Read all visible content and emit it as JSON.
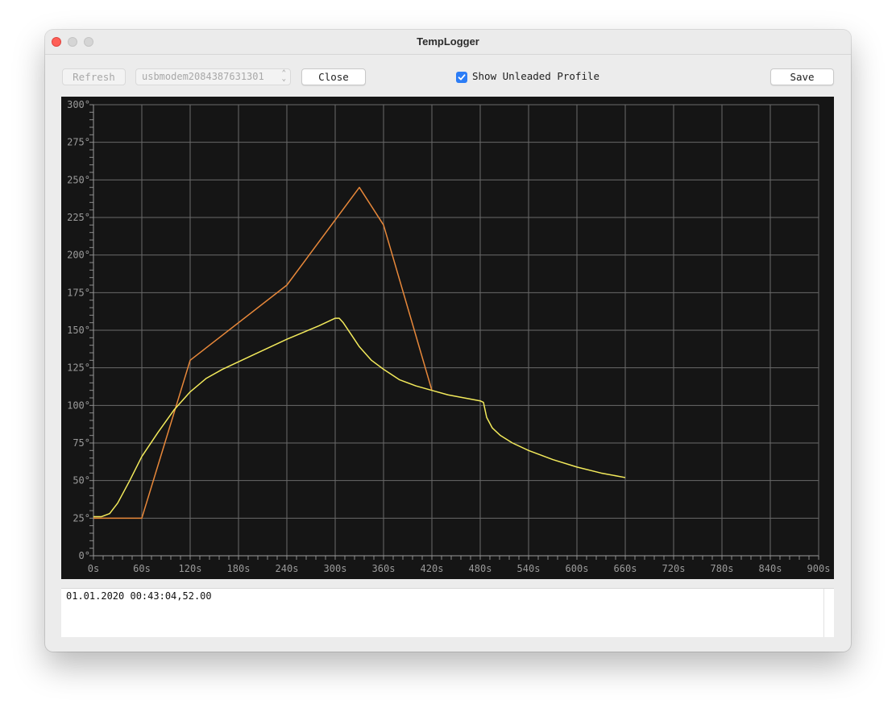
{
  "window": {
    "title": "TempLogger"
  },
  "toolbar": {
    "refresh_label": "Refresh",
    "port_value": "usbmodem2084387631301",
    "close_label": "Close",
    "show_profile_label": "Show Unleaded Profile",
    "show_profile_checked": true,
    "save_label": "Save"
  },
  "log": {
    "text": "01.01.2020 00:43:04,52.00"
  },
  "colors": {
    "profile": "#e8883a",
    "measured": "#f3ea5b",
    "background": "#151515",
    "grid": "#6a6a6a"
  },
  "chart_data": {
    "type": "line",
    "xlim": [
      0,
      900
    ],
    "ylim": [
      0,
      300
    ],
    "x_ticks": [
      0,
      60,
      120,
      180,
      240,
      300,
      360,
      420,
      480,
      540,
      600,
      660,
      720,
      780,
      840,
      900
    ],
    "x_tick_labels": [
      "0s",
      "60s",
      "120s",
      "180s",
      "240s",
      "300s",
      "360s",
      "420s",
      "480s",
      "540s",
      "600s",
      "660s",
      "720s",
      "780s",
      "840s",
      "900s"
    ],
    "y_ticks": [
      0,
      25,
      50,
      75,
      100,
      125,
      150,
      175,
      200,
      225,
      250,
      275,
      300
    ],
    "y_tick_labels": [
      "0°",
      "25°",
      "50°",
      "75°",
      "100°",
      "125°",
      "150°",
      "175°",
      "200°",
      "225°",
      "250°",
      "275°",
      "300°"
    ],
    "grid": true,
    "series": [
      {
        "color": "#e8883a",
        "x": [
          0,
          60,
          120,
          240,
          330,
          360,
          420
        ],
        "y": [
          25,
          25,
          130,
          180,
          245,
          220,
          110
        ]
      },
      {
        "color": "#f3ea5b",
        "x": [
          0,
          10,
          20,
          30,
          45,
          60,
          80,
          100,
          120,
          140,
          160,
          200,
          240,
          280,
          300,
          305,
          310,
          320,
          330,
          345,
          360,
          380,
          400,
          420,
          440,
          460,
          480,
          484,
          488,
          495,
          505,
          520,
          540,
          570,
          600,
          630,
          660
        ],
        "y": [
          26,
          26,
          28,
          35,
          50,
          66,
          82,
          97,
          109,
          118,
          124,
          134,
          144,
          153,
          158,
          158,
          155,
          147,
          139,
          130,
          124,
          117,
          113,
          110,
          107,
          105,
          103,
          102,
          92,
          85,
          80,
          75,
          70,
          64,
          59,
          55,
          52
        ]
      }
    ]
  }
}
